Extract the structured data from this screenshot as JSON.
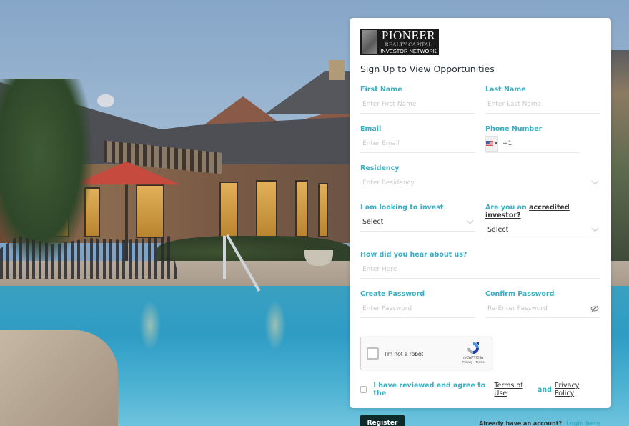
{
  "brand": {
    "line1": "PIONEER",
    "line2": "REALTY CAPITAL",
    "line3": "INVESTOR NETWORK"
  },
  "title": "Sign Up to View Opportunities",
  "form": {
    "first_name": {
      "label": "First Name",
      "placeholder": "Enter First Name",
      "value": ""
    },
    "last_name": {
      "label": "Last Name",
      "placeholder": "Enter Last Name",
      "value": ""
    },
    "email": {
      "label": "Email",
      "placeholder": "Enter Email",
      "value": ""
    },
    "phone": {
      "label": "Phone Number",
      "country": "US",
      "dial_code": "+1",
      "value": ""
    },
    "residency": {
      "label": "Residency",
      "placeholder": "Enter Residency"
    },
    "invest": {
      "label": "I am looking to invest",
      "selected": "Select"
    },
    "accredited": {
      "label_prefix": "Are you an",
      "label_link": "accredited investor?",
      "selected": "Select"
    },
    "heard": {
      "label": "How did you hear about us?",
      "placeholder": "Enter Here",
      "value": ""
    },
    "password": {
      "label": "Create Password",
      "placeholder": "Enter Password",
      "value": ""
    },
    "confirm_password": {
      "label": "Confirm Password",
      "placeholder": "Re-Enter Password",
      "value": ""
    }
  },
  "captcha": {
    "label": "I'm not a robot",
    "brand": "reCAPTCHA",
    "links": "Privacy - Terms",
    "checked": false
  },
  "agreement": {
    "checked": false,
    "prefix": "I have reviewed and agree to the",
    "terms_link": "Terms of Use",
    "conjunction": "and",
    "privacy_link": "Privacy Policy"
  },
  "footer": {
    "register_label": "Register",
    "account_prompt": "Already have an account?",
    "login_link": "Login here"
  },
  "colors": {
    "accent": "#3aaec4",
    "button": "#0e2a2b"
  }
}
